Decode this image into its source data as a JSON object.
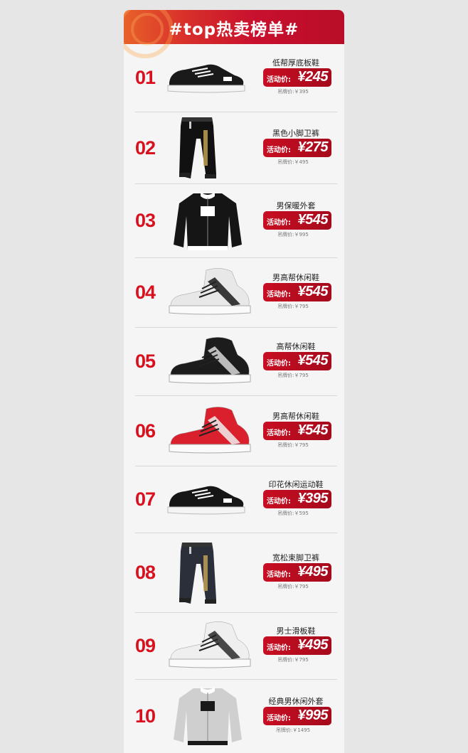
{
  "header": {
    "title": "#top热卖榜单#"
  },
  "price_label": "活动价:",
  "tag_prefix": "吊牌价:",
  "items": [
    {
      "rank": "01",
      "name": "低帮厚底板鞋",
      "price": "¥245",
      "tag": "吊牌价:￥395",
      "icon": "low-top-shoe-icon",
      "color": "#1a1a1a"
    },
    {
      "rank": "02",
      "name": "黑色小脚卫裤",
      "price": "¥275",
      "tag": "吊牌价:￥495",
      "icon": "sweatpants-icon",
      "color": "#111111"
    },
    {
      "rank": "03",
      "name": "男保暖外套",
      "price": "¥545",
      "tag": "吊牌价:￥995",
      "icon": "bomber-jacket-icon",
      "color": "#151515"
    },
    {
      "rank": "04",
      "name": "男高帮休闲鞋",
      "price": "¥545",
      "tag": "吊牌价:￥795",
      "icon": "high-top-shoe-icon",
      "color": "#e8e8e8"
    },
    {
      "rank": "05",
      "name": "高帮休闲鞋",
      "price": "¥545",
      "tag": "吊牌价:￥795",
      "icon": "high-top-shoe-icon",
      "color": "#1c1c1c"
    },
    {
      "rank": "06",
      "name": "男高帮休闲鞋",
      "price": "¥545",
      "tag": "吊牌价:￥795",
      "icon": "high-top-shoe-icon",
      "color": "#d9202c"
    },
    {
      "rank": "07",
      "name": "印花休闲运动鞋",
      "price": "¥395",
      "tag": "吊牌价:￥595",
      "icon": "low-top-shoe-icon",
      "color": "#161616"
    },
    {
      "rank": "08",
      "name": "宽松束脚卫裤",
      "price": "¥495",
      "tag": "吊牌价:￥795",
      "icon": "sweatpants-icon",
      "color": "#2a2f3a"
    },
    {
      "rank": "09",
      "name": "男士滑板鞋",
      "price": "¥495",
      "tag": "吊牌价:￥795",
      "icon": "skate-shoe-icon",
      "color": "#efefef"
    },
    {
      "rank": "10",
      "name": "经典男休闲外套",
      "price": "¥995",
      "tag": "吊牌价:￥1495",
      "icon": "varsity-jacket-icon",
      "color": "#cfcfcf"
    }
  ]
}
